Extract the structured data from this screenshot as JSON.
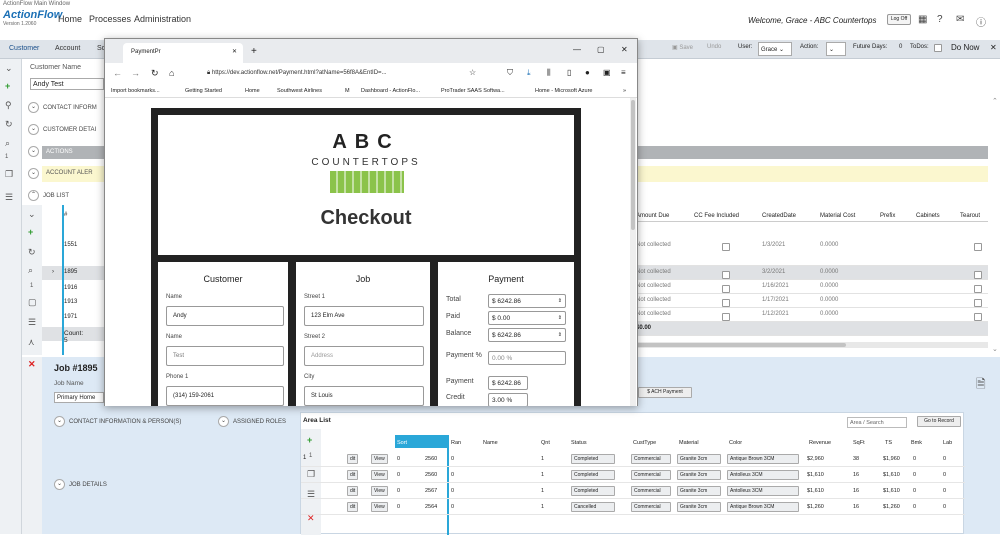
{
  "window": {
    "title": "ActionFlow Main Window"
  },
  "app": {
    "logo": "ActionFlow",
    "version": "Version 1.2060"
  },
  "menu": {
    "home": "Home",
    "processes": "Processes",
    "administration": "Administration"
  },
  "header": {
    "welcome": "Welcome, Grace - ABC Countertops",
    "logoff": "Log Off"
  },
  "tabs": {
    "customer": "Customer",
    "account": "Account",
    "more": "Sc"
  },
  "toolbar": {
    "save": "Save",
    "undo": "Undo",
    "user_label": "User:",
    "user_value": "Grace",
    "action_label": "Action:",
    "future_label": "Future Days:",
    "future_value": "0",
    "todos_label": "ToDos:",
    "donow": "Do Now"
  },
  "customer": {
    "name_label": "Customer Name",
    "name_value": "Andy Test"
  },
  "sections": {
    "contact": "CONTACT INFORM",
    "customer_detail": "CUSTOMER DETAI",
    "actions": "ACTIONS",
    "account_alerts": "ACCOUNT ALER",
    "job_list": "JOB LIST"
  },
  "job_list": {
    "col_num": "#",
    "headers": {
      "amount_due": "Amount Due",
      "cc_fee": "CC Fee Included",
      "created": "CreatedDate",
      "material_cost": "Material Cost",
      "prefix": "Prefix",
      "cabinets": "Cabinets",
      "tearout": "Tearout"
    },
    "rows": [
      {
        "num": "1551",
        "amount": "Not collected",
        "date": "1/3/2021",
        "cost": "0.0000"
      },
      {
        "num": "1895",
        "amount": "Not collected",
        "date": "3/2/2021",
        "cost": "0.0000"
      },
      {
        "num": "1916",
        "amount": "Not collected",
        "date": "1/16/2021",
        "cost": "0.0000"
      },
      {
        "num": "1913",
        "amount": "Not collected",
        "date": "1/17/2021",
        "cost": "0.0000"
      },
      {
        "num": "1971",
        "amount": "Not collected",
        "date": "1/12/2021",
        "cost": "0.0000"
      }
    ],
    "count": "Count: 5",
    "total": "$0.00"
  },
  "job": {
    "title": "Job #1895",
    "name_label": "Job Name",
    "name_value": "Primary Home",
    "contact": "CONTACT INFORMATION & PERSON(S)",
    "roles": "ASSIGNED ROLES",
    "details": "JOB DETAILS",
    "ach": "$ ACH Payment"
  },
  "area_list": {
    "title": "Area List",
    "search_placeholder": "Area / Search",
    "go_record": "Go to Record",
    "headers": {
      "sort": "Sort",
      "ran": "Ran",
      "name": "Name",
      "qnt": "Qnt",
      "status": "Status",
      "cust": "CustType",
      "material": "Material",
      "color": "Color",
      "revenue": "Revenue",
      "sqft": "SqFt",
      "ts": "TS",
      "bmk": "Bmk",
      "lab": "Lab"
    },
    "rows": [
      {
        "edit": "dit",
        "view": "View",
        "sort": "0",
        "ran": "2560",
        "n": "0",
        "qnt": "1",
        "status": "Completed",
        "cust": "Commercial",
        "material": "Granite 3cm",
        "color": "Antique Brown 3CM",
        "revenue": "$2,960",
        "sqft": "38",
        "ts": "$1,960",
        "bmk": "0",
        "lab": "0"
      },
      {
        "edit": "dit",
        "view": "View",
        "sort": "0",
        "ran": "2560",
        "n": "0",
        "qnt": "1",
        "status": "Completed",
        "cust": "Commercial",
        "material": "Granite 3cm",
        "color": "Antolleus 3CM",
        "revenue": "$1,610",
        "sqft": "16",
        "ts": "$1,610",
        "bmk": "0",
        "lab": "0"
      },
      {
        "edit": "dit",
        "view": "View",
        "sort": "0",
        "ran": "2567",
        "n": "0",
        "qnt": "1",
        "status": "Completed",
        "cust": "Commercial",
        "material": "Granite 3cm",
        "color": "Antolleus 3CM",
        "revenue": "$1,610",
        "sqft": "16",
        "ts": "$1,610",
        "bmk": "0",
        "lab": "0"
      },
      {
        "edit": "dit",
        "view": "View",
        "sort": "0",
        "ran": "2564",
        "n": "0",
        "qnt": "1",
        "status": "Cancelled",
        "cust": "Commercial",
        "material": "Granite 3cm",
        "color": "Antique Brown 3CM",
        "revenue": "$1,260",
        "sqft": "16",
        "ts": "$1,260",
        "bmk": "0",
        "lab": "0"
      }
    ]
  },
  "browser": {
    "tab_title": "PaymentPr",
    "url": "https://dev.actionflow.net/Payment.html?atName=56f8A&EntID=...",
    "bookmarks": [
      "Import bookmarks...",
      "Getting Started",
      "Home",
      "Southwest Airlines",
      "M",
      "Dashboard - ActionFlo...",
      "ProTrader SAAS Softwa...",
      "Home - Microsoft Azure"
    ]
  },
  "checkout": {
    "brand_top": "ABC",
    "brand_bottom": "COUNTERTOPS",
    "title": "Checkout",
    "customer": {
      "heading": "Customer",
      "name_label": "Name",
      "name_value": "Andy",
      "last_label": "Name",
      "last_value": "Test",
      "phone_label": "Phone 1",
      "phone_value": "(314) 159-2061"
    },
    "job": {
      "heading": "Job",
      "street1_label": "Street 1",
      "street1_value": "123 Elm Ave",
      "street2_label": "Street 2",
      "street2_value": "Address",
      "city_label": "City",
      "city_value": "St Louis"
    },
    "payment": {
      "heading": "Payment",
      "total_label": "Total",
      "total_value": "$ 6242.86",
      "paid_label": "Paid",
      "paid_value": "$ 0.00",
      "balance_label": "Balance",
      "balance_value": "$ 6242.86",
      "pct_label": "Payment %",
      "pct_value": "0.00",
      "pct_unit": "%",
      "payment_label": "Payment",
      "payment_value": "$ 6242.86",
      "credit_label": "Credit",
      "credit_value": "3.00",
      "credit_unit": "%"
    }
  }
}
